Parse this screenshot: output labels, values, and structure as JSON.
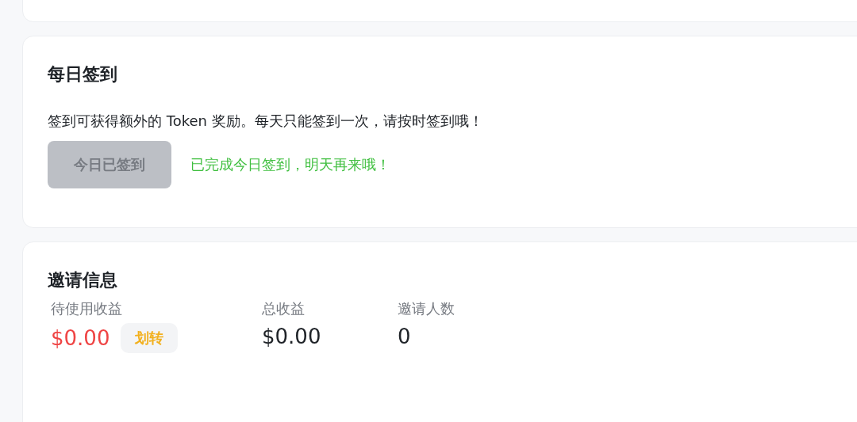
{
  "checkin": {
    "title": "每日签到",
    "description": "签到可获得额外的 Token 奖励。每天只能签到一次，请按时签到哦！",
    "button": {
      "label": "今日已签到",
      "disabled": true
    },
    "status": "已完成今日签到，明天再来哦！"
  },
  "invite": {
    "title": "邀请信息",
    "stats": [
      {
        "label": "待使用收益",
        "value": "$0.00",
        "color": "#ef4444",
        "action": "划转"
      },
      {
        "label": "总收益",
        "value": "$0.00",
        "color": "#1f2328"
      },
      {
        "label": "邀请人数",
        "value": "0",
        "color": "#1f2328"
      }
    ]
  }
}
